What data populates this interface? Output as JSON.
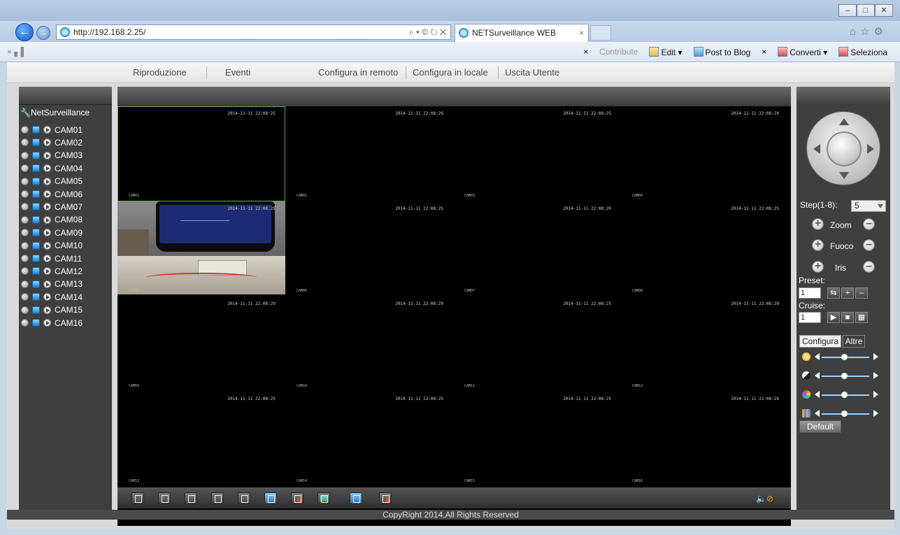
{
  "browser": {
    "url": "http://192.168.2.25/",
    "url_tools": "⌕ ▾ © ↻ ✕",
    "tab_title": "NETSurveillance WEB",
    "tab_close": "×",
    "window_controls": [
      "–",
      "□",
      "✕"
    ],
    "cmdbar_left": "×  ▖▌",
    "cmdbar": {
      "close": "×",
      "contribute": "Contribute",
      "edit": "Edit",
      "post_to_blog": "Post to Blog",
      "close2": "×",
      "converti": "Converti",
      "seleziona": "Seleziona"
    }
  },
  "menu": {
    "items": [
      "Riproduzione",
      "Eventi",
      "Configura in remoto",
      "Configura in locale",
      "Uscita Utente"
    ]
  },
  "tree": {
    "root": "NetSurveillance",
    "cameras": [
      "CAM01",
      "CAM02",
      "CAM03",
      "CAM04",
      "CAM05",
      "CAM06",
      "CAM07",
      "CAM08",
      "CAM09",
      "CAM10",
      "CAM11",
      "CAM12",
      "CAM13",
      "CAM14",
      "CAM15",
      "CAM16"
    ]
  },
  "grid": {
    "timestamps": [
      "2014-11-11 22:08:25",
      "2014-11-11 22:08:29",
      "2014-11-11 22:08:25",
      "2014-11-11 22:08:29",
      "2014-11-11 22:08:25",
      "2014-11-11 22:08:25",
      "2014-11-11 22:08:29",
      "2014-11-11 22:08:25",
      "2014-11-11 22:08:29",
      "2014-11-11 22:08:29",
      "2014-11-11 22:08:25",
      "2014-11-11 22:08:29",
      "2014-11-11 22:08:25",
      "2014-11-11 22:08:25",
      "2014-11-11 22:08:25",
      "2014-11-11 22:08:29"
    ],
    "labels": [
      "CAM01",
      "CAM02",
      "CAM03",
      "CAM04",
      "CAM05",
      "CAM06",
      "CAM07",
      "CAM08",
      "CAM09",
      "CAM10",
      "CAM11",
      "CAM12",
      "CAM13",
      "CAM14",
      "CAM15",
      "CAM16"
    ]
  },
  "ptz": {
    "step_label": "Step(1-8):",
    "step_value": "5",
    "zoom": "Zoom",
    "focus": "Fuoco",
    "iris": "Iris",
    "preset_label": "Preset:",
    "preset_value": "1",
    "cruise_label": "Cruise:",
    "cruise_value": "1",
    "tab_config": "Configura",
    "tab_other": "Altre",
    "default_btn": "Default"
  },
  "footer": {
    "text": "CopyRight 2014,All Rights Reserved"
  }
}
